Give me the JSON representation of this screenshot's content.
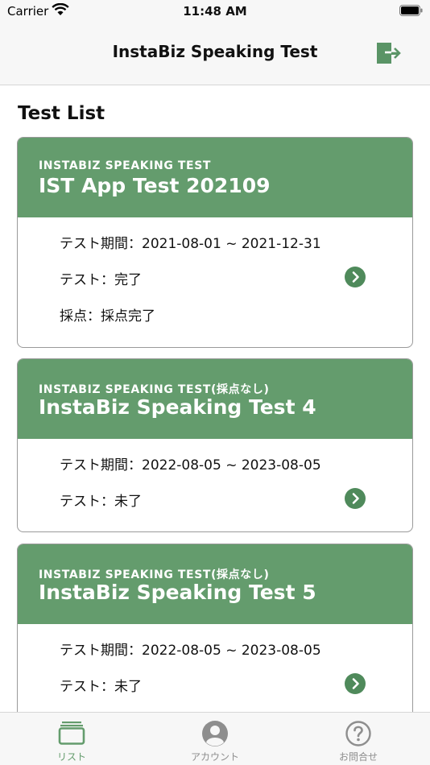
{
  "status_bar": {
    "carrier": "Carrier",
    "time": "11:48 AM"
  },
  "nav": {
    "title": "InstaBiz Speaking Test",
    "logout_icon": "logout-icon"
  },
  "section_title": "Test List",
  "cards": [
    {
      "subtitle": "INSTABIZ SPEAKING TEST",
      "title": "IST App Test 202109",
      "period": "テスト期間：2021-08-01 ~ 2021-12-31",
      "test_status": "テスト：完了",
      "scoring": "採点：採点完了"
    },
    {
      "subtitle": "INSTABIZ SPEAKING TEST(採点なし)",
      "title": "InstaBiz Speaking Test 4",
      "period": "テスト期間：2022-08-05 ~ 2023-08-05",
      "test_status": "テスト：未了"
    },
    {
      "subtitle": "INSTABIZ SPEAKING TEST(採点なし)",
      "title": "InstaBiz Speaking Test 5",
      "period": "テスト期間：2022-08-05 ~ 2023-08-05",
      "test_status": "テスト：未了"
    }
  ],
  "tab_bar": {
    "tabs": [
      {
        "label": "リスト",
        "icon": "list-icon",
        "active": true
      },
      {
        "label": "アカウント",
        "icon": "account-icon",
        "active": false
      },
      {
        "label": "お問合せ",
        "icon": "help-icon",
        "active": false
      }
    ]
  },
  "colors": {
    "accent": "#649c6d",
    "accent_dark": "#4f8a5b",
    "inactive": "#8e8e8e"
  }
}
